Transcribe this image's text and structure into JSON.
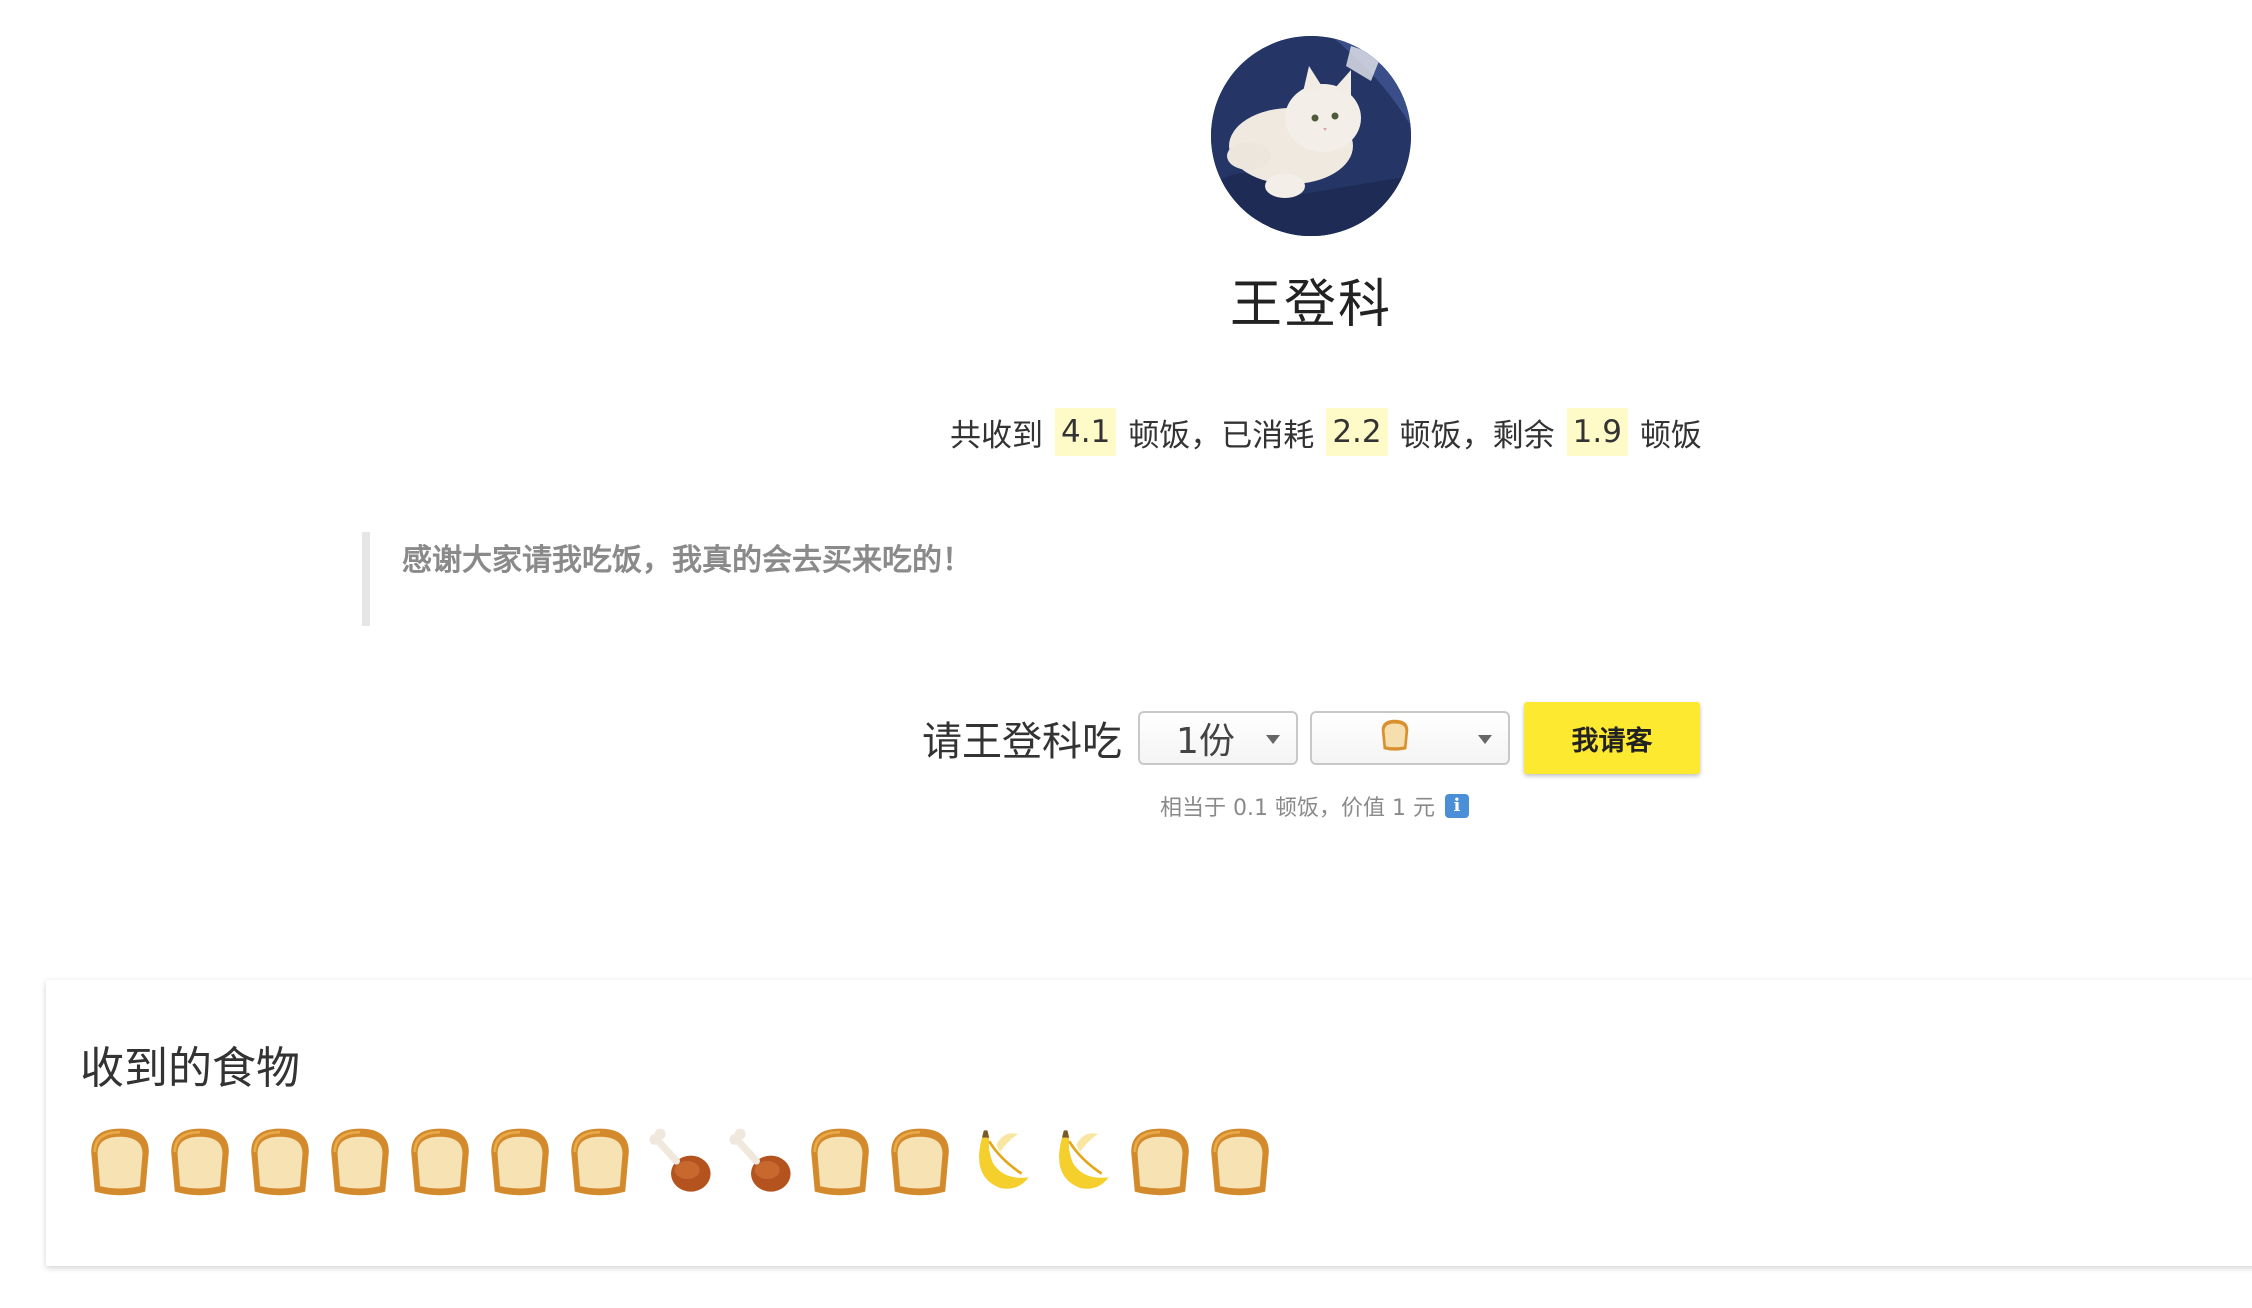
{
  "profile": {
    "name": "王登科"
  },
  "stats": {
    "prefix": "共收到",
    "received": "4.1",
    "unit1": "顿饭，已消耗",
    "consumed": "2.2",
    "unit2": "顿饭，剩余",
    "remaining": "1.9",
    "unit3": "顿饭"
  },
  "quote": "感谢大家请我吃饭，我真的会去买来吃的！",
  "treat": {
    "label": "请王登科吃",
    "quantity_selected": "1份",
    "food_selected_icon": "bread",
    "button_label": "我请客",
    "hint": "相当于 0.1 顿饭，价值 1 元",
    "accent_color": "#fde92f"
  },
  "received_food": {
    "title": "收到的食物",
    "items": [
      "bread",
      "bread",
      "bread",
      "bread",
      "bread",
      "bread",
      "bread",
      "chicken-leg",
      "chicken-leg",
      "bread",
      "bread",
      "banana",
      "banana",
      "bread",
      "bread"
    ]
  }
}
